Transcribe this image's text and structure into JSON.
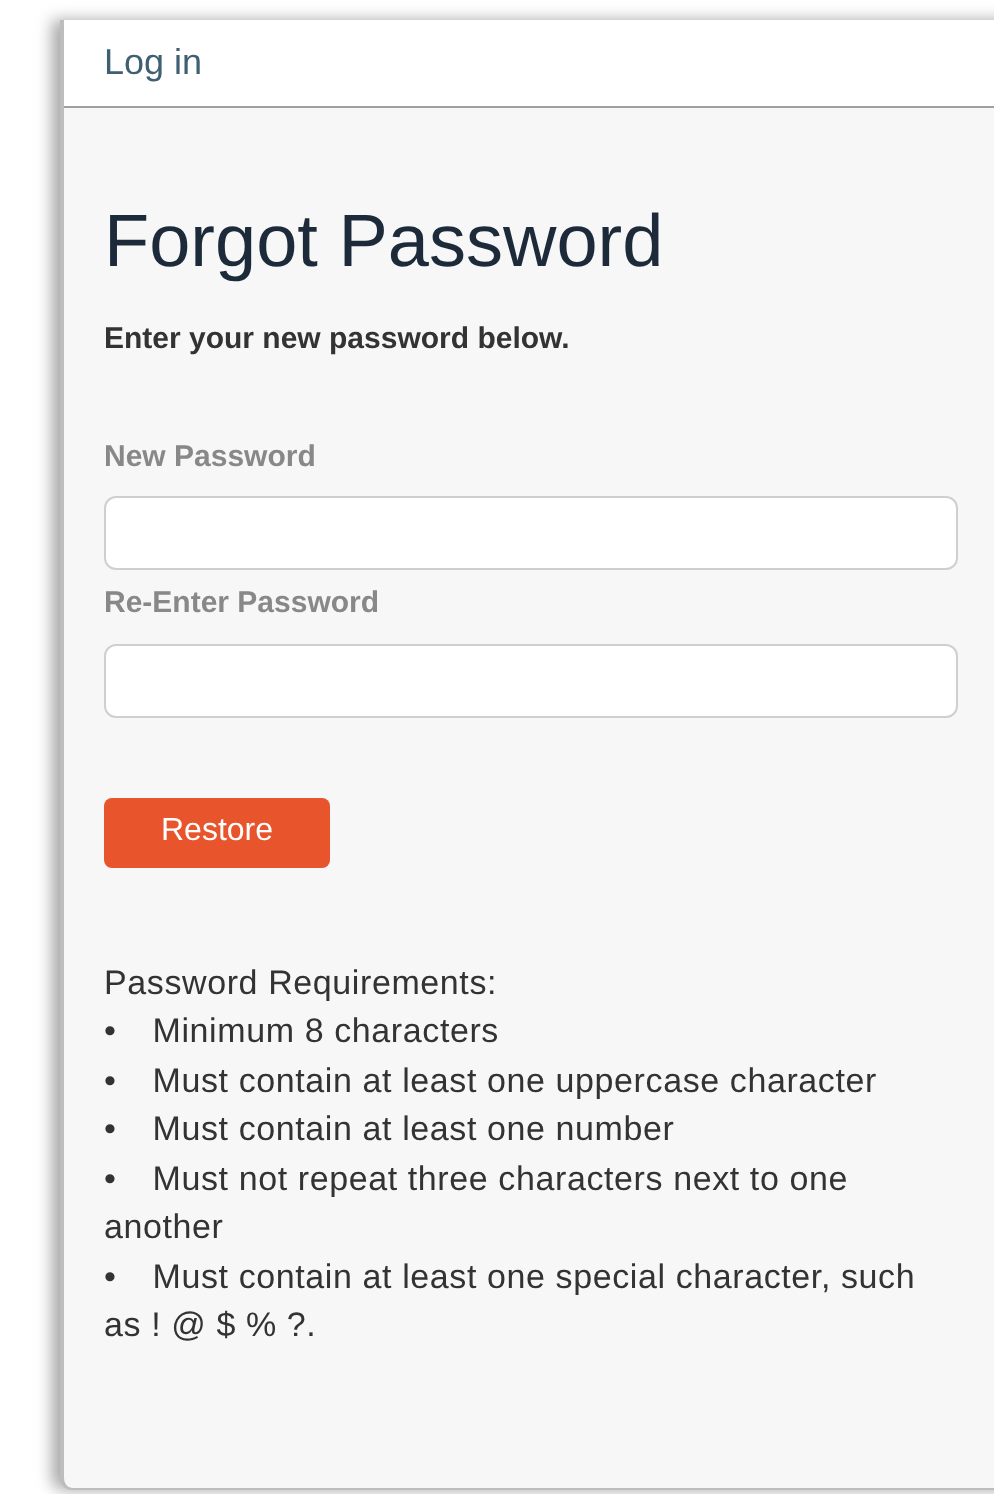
{
  "header": {
    "title": "Log in"
  },
  "heading": "Forgot Password",
  "instruction": "Enter your new password below.",
  "fields": [
    {
      "label": "New Password"
    },
    {
      "label": "Re-Enter Password"
    }
  ],
  "buttons": [
    "Restore"
  ],
  "requirements": {
    "title": "Password Requirements:",
    "items": [
      {
        "bullet": "•",
        "text": "Minimum 8 characters"
      },
      {
        "bullet": "•",
        "text": "Must contain at least one uppercase character"
      },
      {
        "bullet": "•",
        "text": "Must contain at least one number"
      },
      {
        "bullet": "•",
        "text": "Must not repeat three characters next to one another"
      },
      {
        "bullet": "•",
        "text": "Must contain at least one special character, such as ! @ $ % ?."
      }
    ]
  }
}
